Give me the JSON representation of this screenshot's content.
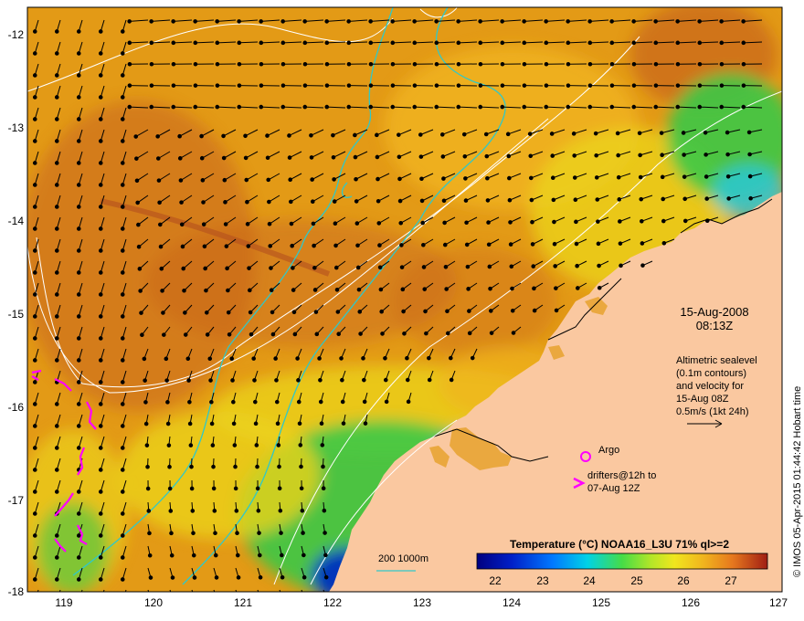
{
  "map": {
    "lon_ticks": [
      "119",
      "120",
      "121",
      "122",
      "123",
      "124",
      "125",
      "126",
      "127"
    ],
    "lat_ticks": [
      "-12",
      "-13",
      "-14",
      "-15",
      "-16",
      "-17",
      "-18"
    ],
    "lon_range": [
      118.6,
      127.0
    ],
    "lat_range": [
      -18.0,
      -11.85
    ]
  },
  "annotation": {
    "date": "15-Aug-2008",
    "time": "08:13Z",
    "altimetry_lines": [
      "Altimetric sealevel",
      "(0.1m contours)",
      "and velocity for",
      "15-Aug 08Z",
      "0.5m/s (1kt 24h)"
    ]
  },
  "legend": {
    "argo_label": "Argo",
    "drifters_line1": "drifters@12h to",
    "drifters_line2": "07-Aug 12Z",
    "bathy_label": "200  1000m"
  },
  "colorbar": {
    "title": "Temperature (°C) NOAA16_L3U 71% ql>=2",
    "ticks": [
      "22",
      "23",
      "24",
      "25",
      "26",
      "27"
    ],
    "range": [
      21.6,
      27.8
    ]
  },
  "credit": "© IMOS 05-Apr-2015 01:44:42 Hobart time",
  "colors": {
    "land": "#fac8a0",
    "warm_sea": "#e39a16",
    "hot_sea": "#c8641e",
    "mid_sea": "#f0b41e",
    "cool_sea": "#ebd21c",
    "green_sea": "#3cc846",
    "cyan_sea": "#2896d2",
    "contour_cyan": "#30c8c8",
    "drifter_magenta": "#ff00ff"
  }
}
